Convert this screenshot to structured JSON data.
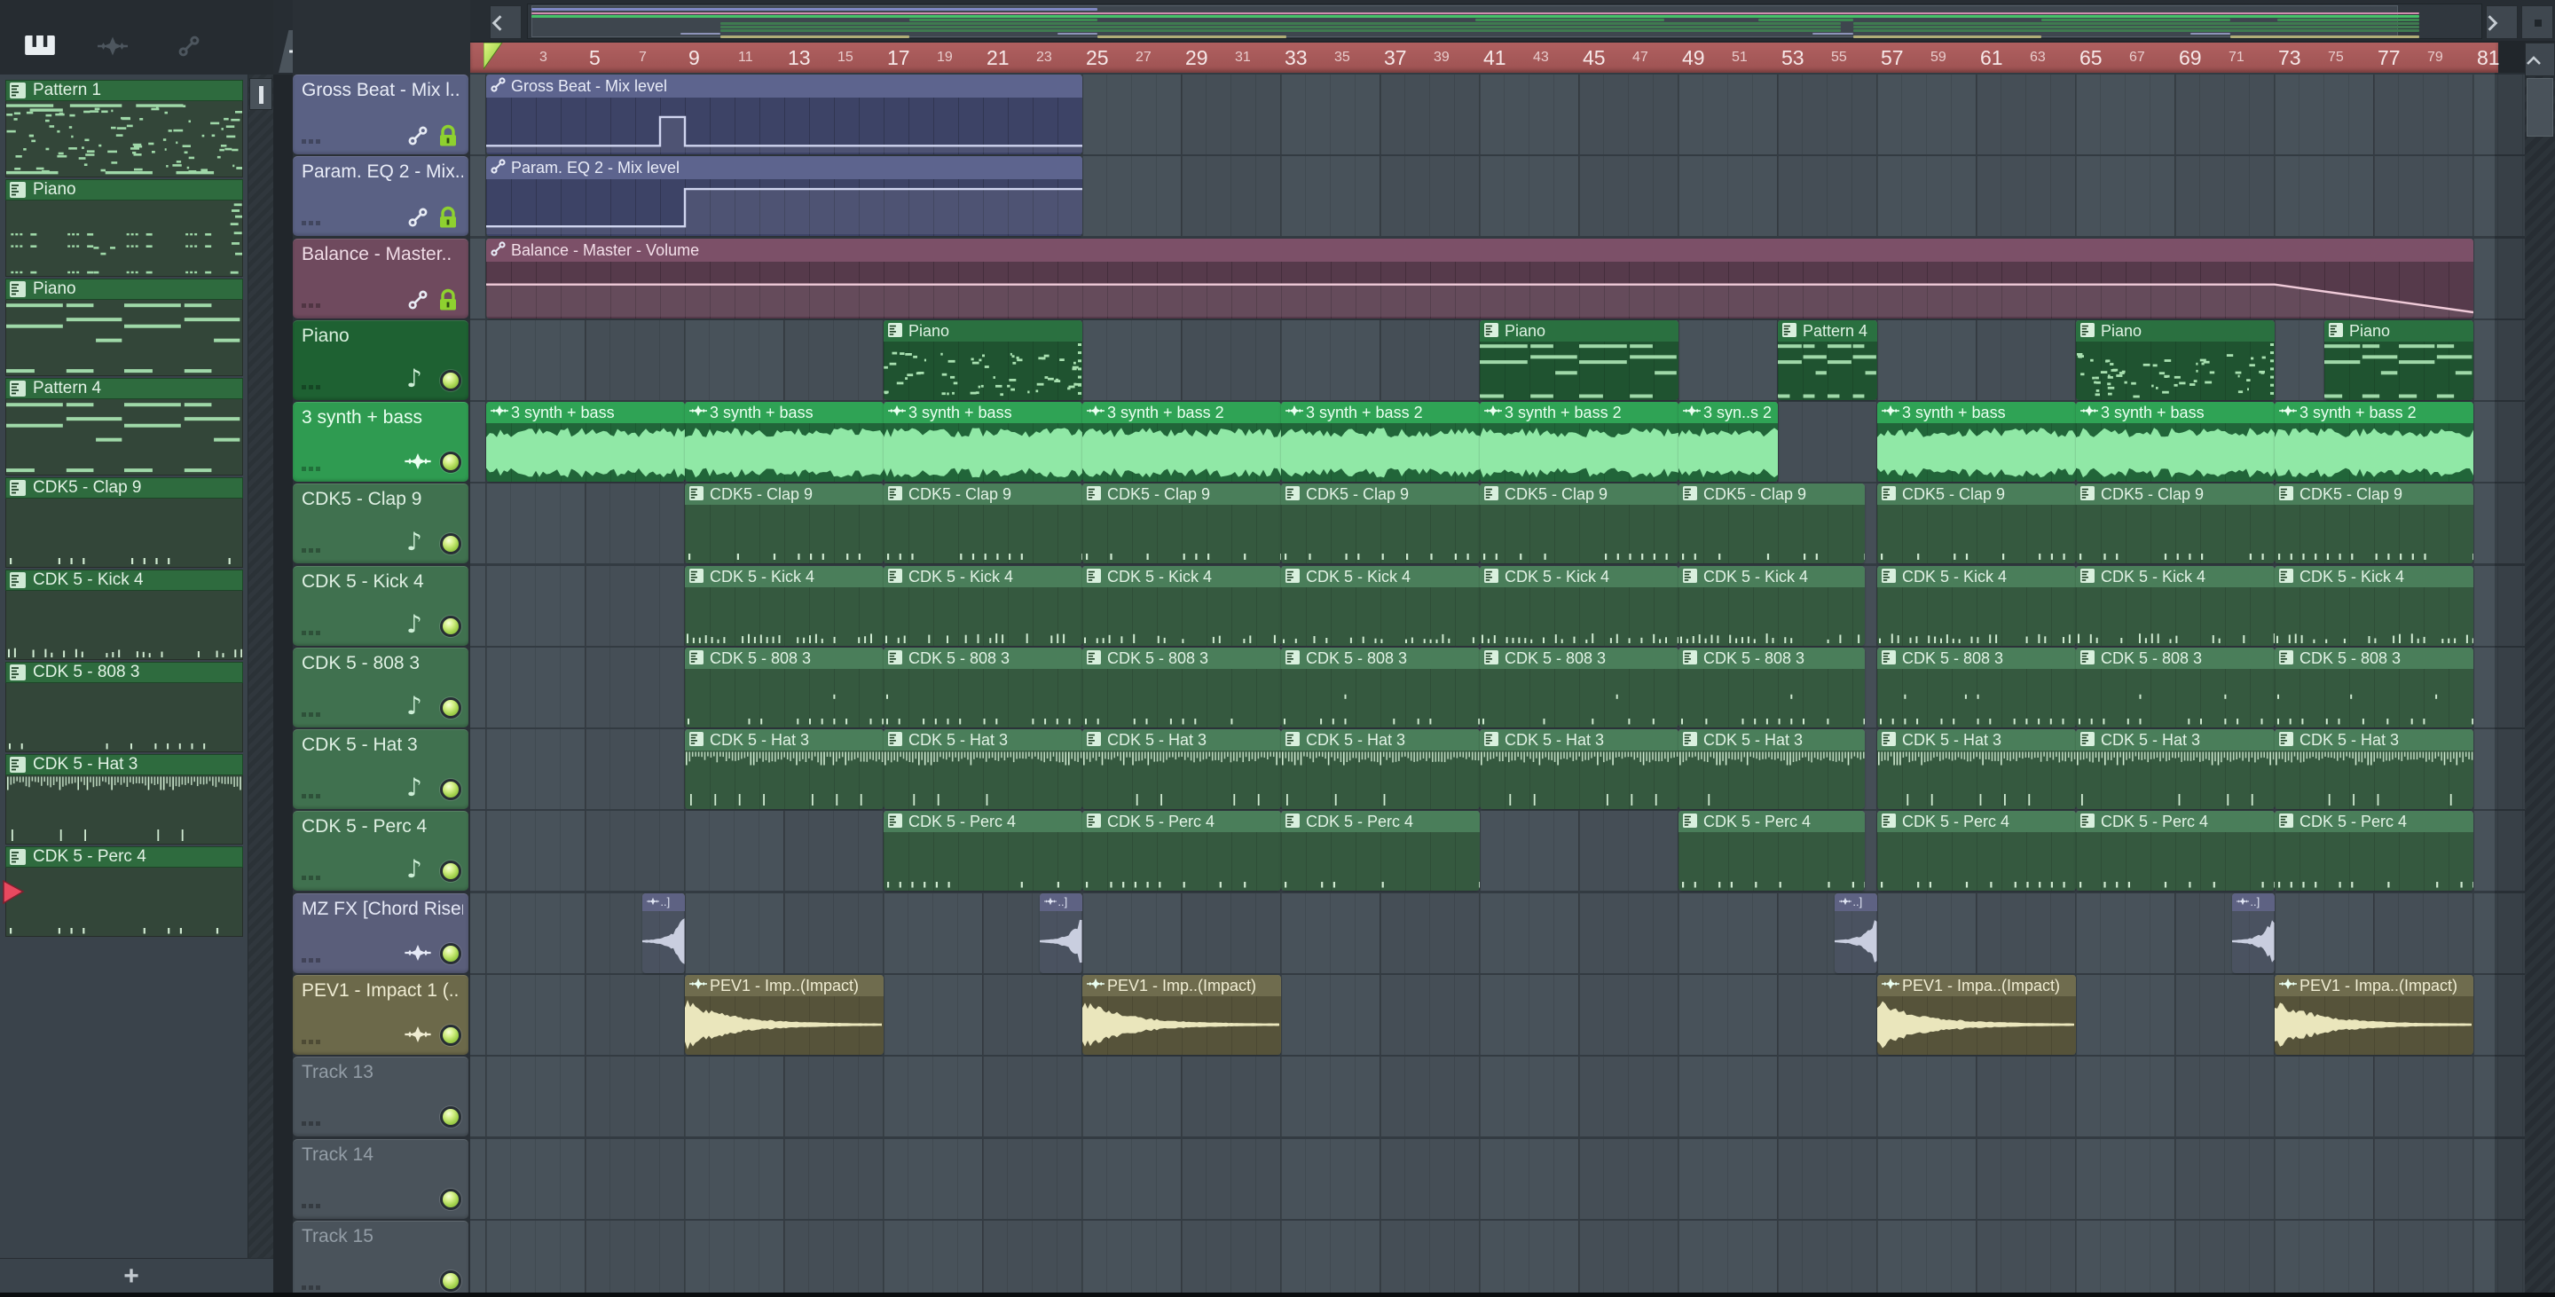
{
  "sidebar": {
    "tabs": [
      {
        "icon": "piano-keys-icon",
        "active": true
      },
      {
        "icon": "audio-wave-icon",
        "active": false
      },
      {
        "icon": "automation-link-icon",
        "active": false
      }
    ],
    "add_label": "+",
    "patterns": [
      {
        "name": "Pattern 1",
        "preview": "dense1"
      },
      {
        "name": "Piano",
        "preview": "clusters"
      },
      {
        "name": "Piano",
        "preview": "chords"
      },
      {
        "name": "Pattern 4",
        "preview": "chords"
      },
      {
        "name": "CDK5 - Clap 9",
        "preview": "clap"
      },
      {
        "name": "CDK 5 - Kick 4",
        "preview": "kick"
      },
      {
        "name": "CDK 5 - 808 3",
        "preview": "t808"
      },
      {
        "name": "CDK 5 - Hat 3",
        "preview": "hat"
      },
      {
        "name": "CDK 5 - Perc 4",
        "preview": "perc"
      }
    ],
    "playing_pattern_index": 8
  },
  "track_toolbar": {
    "add_label": "+",
    "icons": [
      "audio-wave-icon",
      "automation-link-icon",
      "piano-keys-icon",
      "cut-icon",
      "curve-icon",
      "h-arrows-icon"
    ]
  },
  "tracks": [
    {
      "name": "Gross Beat - Mix l..",
      "color": "automation",
      "icons": [
        "link",
        "lock"
      ]
    },
    {
      "name": "Param. EQ 2 - Mix..",
      "color": "automation",
      "icons": [
        "link",
        "lock"
      ]
    },
    {
      "name": "Balance - Master..",
      "color": "balance",
      "icons": [
        "link",
        "lock"
      ]
    },
    {
      "name": "Piano",
      "color": "piano",
      "icons": [
        "note",
        "led"
      ]
    },
    {
      "name": "3 synth + bass",
      "color": "synth",
      "icons": [
        "wave",
        "led"
      ]
    },
    {
      "name": "CDK5 - Clap 9",
      "color": "cdk",
      "icons": [
        "note",
        "led"
      ]
    },
    {
      "name": "CDK 5 - Kick 4",
      "color": "cdk",
      "icons": [
        "note",
        "led"
      ]
    },
    {
      "name": "CDK 5 - 808 3",
      "color": "cdk",
      "icons": [
        "note",
        "led"
      ]
    },
    {
      "name": "CDK 5 - Hat 3",
      "color": "cdk",
      "icons": [
        "note",
        "led"
      ]
    },
    {
      "name": "CDK 5 - Perc 4",
      "color": "cdk",
      "icons": [
        "note",
        "led"
      ]
    },
    {
      "name": "MZ FX [Chord Riser]",
      "color": "mzfx",
      "icons": [
        "wave",
        "led"
      ]
    },
    {
      "name": "PEV1 - Impact 1 (..",
      "color": "pev1",
      "icons": [
        "wave",
        "led"
      ]
    },
    {
      "name": "Track 13",
      "color": "empty",
      "icons": [
        "led"
      ],
      "dim": true
    },
    {
      "name": "Track 14",
      "color": "empty",
      "icons": [
        "led"
      ],
      "dim": true
    },
    {
      "name": "Track 15",
      "color": "empty",
      "icons": [
        "led"
      ],
      "dim": true
    }
  ],
  "timeline": {
    "first_label": 3,
    "last_label": 81,
    "label_step": 2,
    "major_every": 4,
    "start_marker_bar": 1
  },
  "clips": [
    {
      "track": 1,
      "start": 1,
      "end": 25,
      "label": "Gross Beat - Mix level",
      "kind": "autoblue",
      "preview": "automation",
      "auto": "gross"
    },
    {
      "track": 2,
      "start": 1,
      "end": 25,
      "label": "Param. EQ 2 - Mix level",
      "kind": "autoblue",
      "preview": "automation",
      "auto": "param"
    },
    {
      "track": 3,
      "start": 1,
      "end": 81,
      "label": "Balance - Master - Volume",
      "kind": "automaroon",
      "preview": "automation",
      "auto": "balance"
    },
    {
      "track": 4,
      "start": 17,
      "end": 25,
      "label": "Piano",
      "kind": "piano",
      "preview": "pdense"
    },
    {
      "track": 4,
      "start": 41,
      "end": 49,
      "label": "Piano",
      "kind": "piano",
      "preview": "chords"
    },
    {
      "track": 4,
      "start": 53,
      "end": 57,
      "label": "Pattern 4",
      "kind": "piano",
      "preview": "chords"
    },
    {
      "track": 4,
      "start": 65,
      "end": 73,
      "label": "Piano",
      "kind": "piano",
      "preview": "pdense"
    },
    {
      "track": 4,
      "start": 75,
      "end": 81,
      "label": "Piano",
      "kind": "piano",
      "preview": "chords"
    },
    {
      "track": 5,
      "start": 1,
      "end": 9,
      "label": "3 synth + bass",
      "kind": "synth",
      "preview": "wave"
    },
    {
      "track": 5,
      "start": 9,
      "end": 17,
      "label": "3 synth + bass",
      "kind": "synth",
      "preview": "wave"
    },
    {
      "track": 5,
      "start": 17,
      "end": 25,
      "label": "3 synth + bass",
      "kind": "synth",
      "preview": "wave"
    },
    {
      "track": 5,
      "start": 25,
      "end": 33,
      "label": "3 synth + bass 2",
      "kind": "synth",
      "preview": "wave"
    },
    {
      "track": 5,
      "start": 33,
      "end": 41,
      "label": "3 synth + bass 2",
      "kind": "synth",
      "preview": "wave"
    },
    {
      "track": 5,
      "start": 41,
      "end": 49,
      "label": "3 synth + bass 2",
      "kind": "synth",
      "preview": "wave"
    },
    {
      "track": 5,
      "start": 49,
      "end": 53,
      "label": "3 syn..s 2",
      "kind": "synth",
      "preview": "wave"
    },
    {
      "track": 5,
      "start": 57,
      "end": 65,
      "label": "3 synth + bass",
      "kind": "synth",
      "preview": "wave"
    },
    {
      "track": 5,
      "start": 65,
      "end": 73,
      "label": "3 synth + bass",
      "kind": "synth",
      "preview": "wave"
    },
    {
      "track": 5,
      "start": 73,
      "end": 81,
      "label": "3 synth + bass 2",
      "kind": "synth",
      "preview": "wave"
    },
    {
      "track": 6,
      "start": 9,
      "end": 17,
      "label": "CDK5 - Clap 9",
      "kind": "cdk",
      "preview": "clap"
    },
    {
      "track": 6,
      "start": 17,
      "end": 25,
      "label": "CDK5 - Clap 9",
      "kind": "cdk",
      "preview": "clap"
    },
    {
      "track": 6,
      "start": 25,
      "end": 33,
      "label": "CDK5 - Clap 9",
      "kind": "cdk",
      "preview": "clap"
    },
    {
      "track": 6,
      "start": 33,
      "end": 41,
      "label": "CDK5 - Clap 9",
      "kind": "cdk",
      "preview": "clap"
    },
    {
      "track": 6,
      "start": 41,
      "end": 49,
      "label": "CDK5 - Clap 9",
      "kind": "cdk",
      "preview": "clap"
    },
    {
      "track": 6,
      "start": 49,
      "end": 56.5,
      "label": "CDK5 - Clap 9",
      "kind": "cdk",
      "preview": "clap"
    },
    {
      "track": 6,
      "start": 57,
      "end": 65,
      "label": "CDK5 - Clap 9",
      "kind": "cdk",
      "preview": "clap"
    },
    {
      "track": 6,
      "start": 65,
      "end": 73,
      "label": "CDK5 - Clap 9",
      "kind": "cdk",
      "preview": "clap"
    },
    {
      "track": 6,
      "start": 73,
      "end": 81,
      "label": "CDK5 - Clap 9",
      "kind": "cdk",
      "preview": "clap"
    },
    {
      "track": 7,
      "start": 9,
      "end": 17,
      "label": "CDK 5 - Kick 4",
      "kind": "cdk",
      "preview": "kick"
    },
    {
      "track": 7,
      "start": 17,
      "end": 25,
      "label": "CDK 5 - Kick 4",
      "kind": "cdk",
      "preview": "kick"
    },
    {
      "track": 7,
      "start": 25,
      "end": 33,
      "label": "CDK 5 - Kick 4",
      "kind": "cdk",
      "preview": "kick"
    },
    {
      "track": 7,
      "start": 33,
      "end": 41,
      "label": "CDK 5 - Kick 4",
      "kind": "cdk",
      "preview": "kick"
    },
    {
      "track": 7,
      "start": 41,
      "end": 49,
      "label": "CDK 5 - Kick 4",
      "kind": "cdk",
      "preview": "kick"
    },
    {
      "track": 7,
      "start": 49,
      "end": 56.5,
      "label": "CDK 5 - Kick 4",
      "kind": "cdk",
      "preview": "kick"
    },
    {
      "track": 7,
      "start": 57,
      "end": 65,
      "label": "CDK 5 - Kick 4",
      "kind": "cdk",
      "preview": "kick"
    },
    {
      "track": 7,
      "start": 65,
      "end": 73,
      "label": "CDK 5 - Kick 4",
      "kind": "cdk",
      "preview": "kick"
    },
    {
      "track": 7,
      "start": 73,
      "end": 81,
      "label": "CDK 5 - Kick 4",
      "kind": "cdk",
      "preview": "kick"
    },
    {
      "track": 8,
      "start": 9,
      "end": 17,
      "label": "CDK 5 - 808 3",
      "kind": "cdk",
      "preview": "t808"
    },
    {
      "track": 8,
      "start": 17,
      "end": 25,
      "label": "CDK 5 - 808 3",
      "kind": "cdk",
      "preview": "t808"
    },
    {
      "track": 8,
      "start": 25,
      "end": 33,
      "label": "CDK 5 - 808 3",
      "kind": "cdk",
      "preview": "t808"
    },
    {
      "track": 8,
      "start": 33,
      "end": 41,
      "label": "CDK 5 - 808 3",
      "kind": "cdk",
      "preview": "t808"
    },
    {
      "track": 8,
      "start": 41,
      "end": 49,
      "label": "CDK 5 - 808 3",
      "kind": "cdk",
      "preview": "t808"
    },
    {
      "track": 8,
      "start": 49,
      "end": 56.5,
      "label": "CDK 5 - 808 3",
      "kind": "cdk",
      "preview": "t808"
    },
    {
      "track": 8,
      "start": 57,
      "end": 65,
      "label": "CDK 5 - 808 3",
      "kind": "cdk",
      "preview": "t808"
    },
    {
      "track": 8,
      "start": 65,
      "end": 73,
      "label": "CDK 5 - 808 3",
      "kind": "cdk",
      "preview": "t808"
    },
    {
      "track": 8,
      "start": 73,
      "end": 81,
      "label": "CDK 5 - 808 3",
      "kind": "cdk",
      "preview": "t808"
    },
    {
      "track": 9,
      "start": 9,
      "end": 17,
      "label": "CDK 5 - Hat 3",
      "kind": "cdk",
      "preview": "hat"
    },
    {
      "track": 9,
      "start": 17,
      "end": 25,
      "label": "CDK 5 - Hat 3",
      "kind": "cdk",
      "preview": "hat"
    },
    {
      "track": 9,
      "start": 25,
      "end": 33,
      "label": "CDK 5 - Hat 3",
      "kind": "cdk",
      "preview": "hat"
    },
    {
      "track": 9,
      "start": 33,
      "end": 41,
      "label": "CDK 5 - Hat 3",
      "kind": "cdk",
      "preview": "hat"
    },
    {
      "track": 9,
      "start": 41,
      "end": 49,
      "label": "CDK 5 - Hat 3",
      "kind": "cdk",
      "preview": "hat"
    },
    {
      "track": 9,
      "start": 49,
      "end": 56.5,
      "label": "CDK 5 - Hat 3",
      "kind": "cdk",
      "preview": "hat"
    },
    {
      "track": 9,
      "start": 57,
      "end": 65,
      "label": "CDK 5 - Hat 3",
      "kind": "cdk",
      "preview": "hat"
    },
    {
      "track": 9,
      "start": 65,
      "end": 73,
      "label": "CDK 5 - Hat 3",
      "kind": "cdk",
      "preview": "hat"
    },
    {
      "track": 9,
      "start": 73,
      "end": 81,
      "label": "CDK 5 - Hat 3",
      "kind": "cdk",
      "preview": "hat"
    },
    {
      "track": 10,
      "start": 17,
      "end": 25,
      "label": "CDK 5 - Perc 4",
      "kind": "cdk",
      "preview": "perc"
    },
    {
      "track": 10,
      "start": 25,
      "end": 33,
      "label": "CDK 5 - Perc 4",
      "kind": "cdk",
      "preview": "perc"
    },
    {
      "track": 10,
      "start": 33,
      "end": 41,
      "label": "CDK 5 - Perc 4",
      "kind": "cdk",
      "preview": "perc"
    },
    {
      "track": 10,
      "start": 49,
      "end": 56.5,
      "label": "CDK 5 - Perc 4",
      "kind": "cdk",
      "preview": "perc"
    },
    {
      "track": 10,
      "start": 57,
      "end": 65,
      "label": "CDK 5 - Perc 4",
      "kind": "cdk",
      "preview": "perc"
    },
    {
      "track": 10,
      "start": 65,
      "end": 73,
      "label": "CDK 5 - Perc 4",
      "kind": "cdk",
      "preview": "perc"
    },
    {
      "track": 10,
      "start": 73,
      "end": 81,
      "label": "CDK 5 - Perc 4",
      "kind": "cdk",
      "preview": "perc"
    },
    {
      "track": 11,
      "start": 7.3,
      "end": 9,
      "label": "..]",
      "kind": "mzfx",
      "preview": "riser"
    },
    {
      "track": 11,
      "start": 23.3,
      "end": 25,
      "label": "..]",
      "kind": "mzfx",
      "preview": "riser"
    },
    {
      "track": 11,
      "start": 55.3,
      "end": 57,
      "label": "..]",
      "kind": "mzfx",
      "preview": "riser"
    },
    {
      "track": 11,
      "start": 71.3,
      "end": 73,
      "label": "..]",
      "kind": "mzfx",
      "preview": "riser"
    },
    {
      "track": 12,
      "start": 9,
      "end": 17,
      "label": "PEV1 - Imp..(Impact)",
      "kind": "pev1",
      "preview": "impact"
    },
    {
      "track": 12,
      "start": 25,
      "end": 33,
      "label": "PEV1 - Imp..(Impact)",
      "kind": "pev1",
      "preview": "impact"
    },
    {
      "track": 12,
      "start": 57,
      "end": 65,
      "label": "PEV1 - Impa..(Impact)",
      "kind": "pev1",
      "preview": "impact"
    },
    {
      "track": 12,
      "start": 73,
      "end": 81,
      "label": "PEV1 - Impa..(Impact)",
      "kind": "pev1",
      "preview": "impact"
    }
  ],
  "automations": {
    "gross": [
      [
        1,
        0.95
      ],
      [
        8,
        0.95
      ],
      [
        8,
        0.35
      ],
      [
        9,
        0.35
      ],
      [
        9,
        0.95
      ],
      [
        25,
        0.95
      ]
    ],
    "param": [
      [
        1,
        0.93
      ],
      [
        9,
        0.93
      ],
      [
        9,
        0.15
      ],
      [
        25,
        0.15
      ]
    ],
    "balance": [
      [
        1,
        0.42
      ],
      [
        73,
        0.42
      ],
      [
        81,
        1.0
      ]
    ]
  },
  "minimap": {
    "rows": [
      {
        "y": 4,
        "h": 3,
        "color": "#7f88c4",
        "segs": [
          [
            1,
            25
          ]
        ]
      },
      {
        "y": 9,
        "h": 2,
        "color": "#d08fae",
        "segs": [
          [
            1,
            81
          ]
        ]
      },
      {
        "y": 12,
        "h": 3,
        "color": "#45c268",
        "segs": [
          [
            1,
            81
          ]
        ]
      },
      {
        "y": 16,
        "h": 3,
        "color": "#3d8a52",
        "segs": [
          [
            17,
            25
          ],
          [
            41,
            49
          ],
          [
            53,
            57
          ],
          [
            65,
            73
          ],
          [
            75,
            81
          ]
        ]
      },
      {
        "y": 20,
        "h": 3,
        "color": "#3f7a50",
        "segs": [
          [
            9,
            56.5
          ],
          [
            57,
            81
          ]
        ]
      },
      {
        "y": 24,
        "h": 3,
        "color": "#3f7a50",
        "segs": [
          [
            9,
            56.5
          ],
          [
            57,
            81
          ]
        ]
      },
      {
        "y": 28,
        "h": 3,
        "color": "#3f7a50",
        "segs": [
          [
            9,
            56.5
          ],
          [
            57,
            81
          ]
        ]
      },
      {
        "y": 32,
        "h": 2,
        "color": "#8d93b8",
        "segs": [
          [
            7.3,
            9
          ],
          [
            23.3,
            25
          ],
          [
            55.3,
            57
          ],
          [
            71.3,
            73
          ]
        ]
      },
      {
        "y": 35,
        "h": 3,
        "color": "#b0ad77",
        "segs": [
          [
            9,
            17
          ],
          [
            25,
            33
          ],
          [
            57,
            65
          ],
          [
            73,
            81
          ]
        ]
      }
    ]
  },
  "colors": {
    "automation": "#5a6184",
    "balance": "#6f4a5e",
    "piano": "#1e6132",
    "synth": "#2f9b51",
    "cdk": "#40714f",
    "mzfx": "#5a5e7a",
    "pev1": "#6c694a",
    "empty": "#4a535b",
    "ruler": "#a65b5b",
    "lock": "#8ed12f",
    "notes": "#9fd8a8",
    "play_arrow": "#e8495f"
  }
}
